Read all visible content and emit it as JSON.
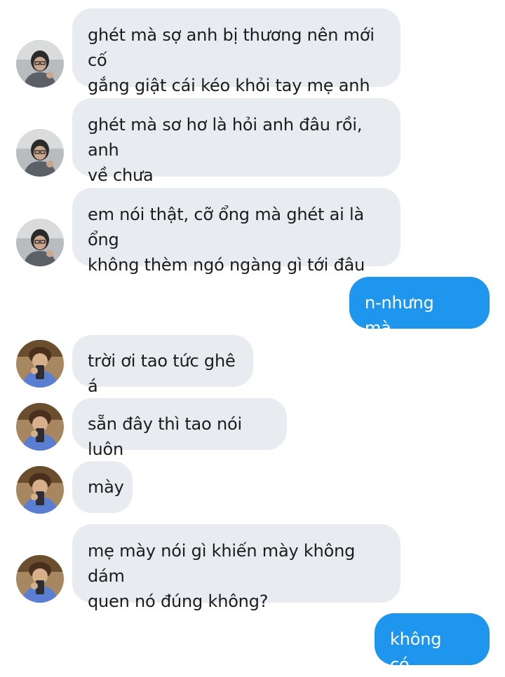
{
  "messages": [
    {
      "id": "m1",
      "side": "incoming",
      "avatar": "avatar-a",
      "lines": [
        "ghét mà sợ anh bị thương nên mới cố",
        "gắng giật cái kéo khỏi tay mẹ anh"
      ]
    },
    {
      "id": "m2",
      "side": "incoming",
      "avatar": "avatar-a",
      "lines": [
        "ghét mà sơ hơ là hỏi anh đâu rồi, anh",
        "về chưa"
      ]
    },
    {
      "id": "m3",
      "side": "incoming",
      "avatar": "avatar-a",
      "lines": [
        "em nói thật, cỡ ổng mà ghét ai là ổng",
        "không thèm ngó ngàng gì tới đâu"
      ]
    },
    {
      "id": "m4",
      "side": "outgoing",
      "lines": [
        "n-nhưng mà..."
      ]
    },
    {
      "id": "m5",
      "side": "incoming",
      "avatar": "avatar-b",
      "lines": [
        "trời ơi tao tức ghê á"
      ]
    },
    {
      "id": "m6",
      "side": "incoming",
      "avatar": "avatar-b",
      "lines": [
        "sẵn đây thì tao nói luôn"
      ]
    },
    {
      "id": "m7",
      "side": "incoming",
      "avatar": "avatar-b",
      "lines": [
        "mày"
      ]
    },
    {
      "id": "m8",
      "side": "incoming",
      "avatar": "avatar-b",
      "lines": [
        "mẹ mày nói gì khiến mày không dám",
        "quen nó đúng không?"
      ]
    },
    {
      "id": "m9",
      "side": "outgoing",
      "lines": [
        "không có..."
      ]
    }
  ],
  "colors": {
    "incoming_bubble": "#e8ebf0",
    "outgoing_bubble": "#1f96ee",
    "incoming_text": "#1c1c1c",
    "outgoing_text": "#ffffff"
  }
}
